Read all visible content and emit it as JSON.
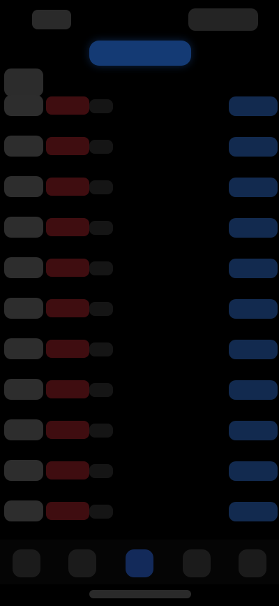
{
  "screen": {
    "name": "order-book",
    "accent_color": "#143a74",
    "sell_color": "#3f0d10",
    "buy_color": "#122a4f"
  },
  "status_bar": {
    "time_icon": "time",
    "status_icons": [
      "signal-icon",
      "wifi-icon",
      "battery-icon"
    ]
  },
  "header": {
    "segment_active_label": ""
  },
  "book": {
    "rows": [
      {
        "label": "",
        "sell": "",
        "buy": ""
      },
      {
        "label": "",
        "sell": "",
        "buy": ""
      },
      {
        "label": "",
        "sell": "",
        "buy": ""
      },
      {
        "label": "",
        "sell": "",
        "buy": ""
      },
      {
        "label": "",
        "sell": "",
        "buy": ""
      },
      {
        "label": "",
        "sell": "",
        "buy": ""
      },
      {
        "label": "",
        "sell": "",
        "buy": ""
      },
      {
        "label": "",
        "sell": "",
        "buy": ""
      },
      {
        "label": "",
        "sell": "",
        "buy": ""
      },
      {
        "label": "",
        "sell": "",
        "buy": ""
      },
      {
        "label": "",
        "sell": "",
        "buy": ""
      }
    ]
  },
  "tabbar": {
    "tabs": [
      {
        "icon": "home-icon",
        "label": ""
      },
      {
        "icon": "markets-icon",
        "label": ""
      },
      {
        "icon": "trade-icon",
        "label": "",
        "active": true
      },
      {
        "icon": "orders-icon",
        "label": ""
      },
      {
        "icon": "profile-icon",
        "label": ""
      }
    ]
  }
}
